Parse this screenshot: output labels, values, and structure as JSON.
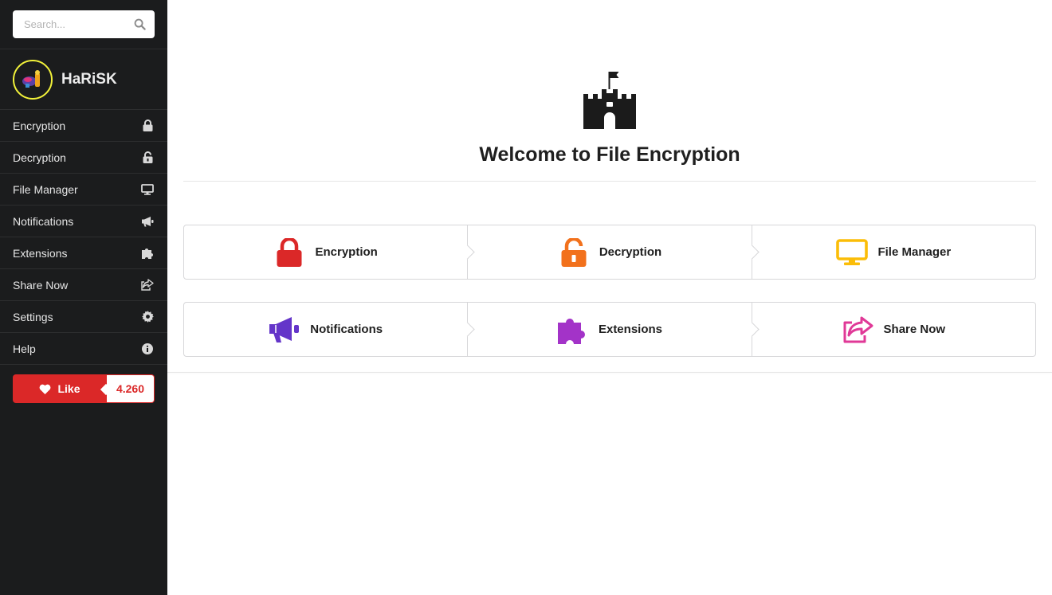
{
  "search": {
    "placeholder": "Search..."
  },
  "profile": {
    "name": "HaRiSK"
  },
  "sidebar": {
    "items": [
      {
        "label": "Encryption",
        "icon": "lock-icon"
      },
      {
        "label": "Decryption",
        "icon": "unlock-icon"
      },
      {
        "label": "File Manager",
        "icon": "desktop-icon"
      },
      {
        "label": "Notifications",
        "icon": "bullhorn-icon"
      },
      {
        "label": "Extensions",
        "icon": "puzzle-icon"
      },
      {
        "label": "Share Now",
        "icon": "share-icon"
      },
      {
        "label": "Settings",
        "icon": "gear-icon"
      },
      {
        "label": "Help",
        "icon": "info-icon"
      }
    ]
  },
  "like": {
    "label": "Like",
    "count": "4.260",
    "color": "#db2828"
  },
  "hero": {
    "title": "Welcome to File Encryption",
    "icon": "castle-icon"
  },
  "steps": {
    "row1": [
      {
        "label": "Encryption",
        "icon": "lock-icon",
        "color": "#db2828"
      },
      {
        "label": "Decryption",
        "icon": "unlock-icon",
        "color": "#f2711c"
      },
      {
        "label": "File Manager",
        "icon": "desktop-icon",
        "color": "#fbbd08"
      }
    ],
    "row2": [
      {
        "label": "Notifications",
        "icon": "bullhorn-icon",
        "color": "#6435c9"
      },
      {
        "label": "Extensions",
        "icon": "puzzle-icon",
        "color": "#a333c8"
      },
      {
        "label": "Share Now",
        "icon": "share-icon",
        "color": "#e03997"
      }
    ]
  }
}
